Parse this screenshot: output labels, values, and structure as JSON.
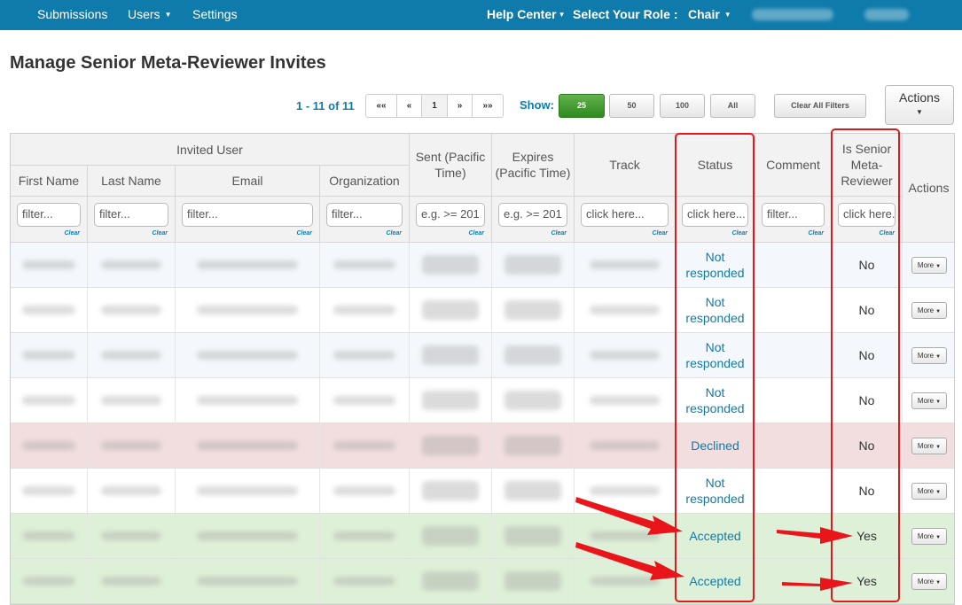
{
  "nav": {
    "submissions": "Submissions",
    "users": "Users",
    "settings": "Settings",
    "help_center": "Help Center",
    "select_role_label": "Select Your Role :",
    "role": "Chair"
  },
  "page_title": "Manage Senior Meta-Reviewer Invites",
  "pager": {
    "info": "1 - 11 of 11",
    "first": "««",
    "prev": "«",
    "page": "1",
    "next": "»",
    "last": "»»"
  },
  "show": {
    "label": "Show:",
    "options": [
      "25",
      "50",
      "100",
      "All"
    ],
    "selected": "25"
  },
  "clear_all_filters": "Clear All Filters",
  "actions_button": "Actions",
  "table": {
    "group_header": "Invited User",
    "columns": {
      "first_name": "First Name",
      "last_name": "Last Name",
      "email": "Email",
      "organization": "Organization",
      "sent": "Sent (Pacific Time)",
      "expires": "Expires (Pacific Time)",
      "track": "Track",
      "status": "Status",
      "comment": "Comment",
      "senior": "Is Senior Meta-Reviewer",
      "actions": "Actions"
    },
    "filters": {
      "first_name": "filter...",
      "last_name": "filter...",
      "email": "filter...",
      "organization": "filter...",
      "sent": "e.g. >= 201",
      "expires": "e.g. >= 201",
      "track": "click here...",
      "status": "click here...",
      "comment": "filter...",
      "senior": "click here...",
      "clear": "Clear"
    },
    "rows": [
      {
        "status": "Not responded",
        "senior": "No",
        "tone": "light",
        "action": "More"
      },
      {
        "status": "Not responded",
        "senior": "No",
        "tone": "white",
        "action": "More"
      },
      {
        "status": "Not responded",
        "senior": "No",
        "tone": "light",
        "action": "More"
      },
      {
        "status": "Not responded",
        "senior": "No",
        "tone": "white",
        "action": "More"
      },
      {
        "status": "Declined",
        "senior": "No",
        "tone": "red",
        "action": "More"
      },
      {
        "status": "Not responded",
        "senior": "No",
        "tone": "white",
        "action": "More"
      },
      {
        "status": "Accepted",
        "senior": "Yes",
        "tone": "green",
        "action": "More"
      },
      {
        "status": "Accepted",
        "senior": "Yes",
        "tone": "green",
        "action": "More"
      }
    ]
  },
  "colors": {
    "nav_bg": "#0f7bab",
    "link": "#0f7bab",
    "row_light": "#f4f8fc",
    "row_white": "#ffffff",
    "row_red": "#f2dede",
    "row_green": "#dff0d8",
    "annotation": "#e8161b"
  }
}
